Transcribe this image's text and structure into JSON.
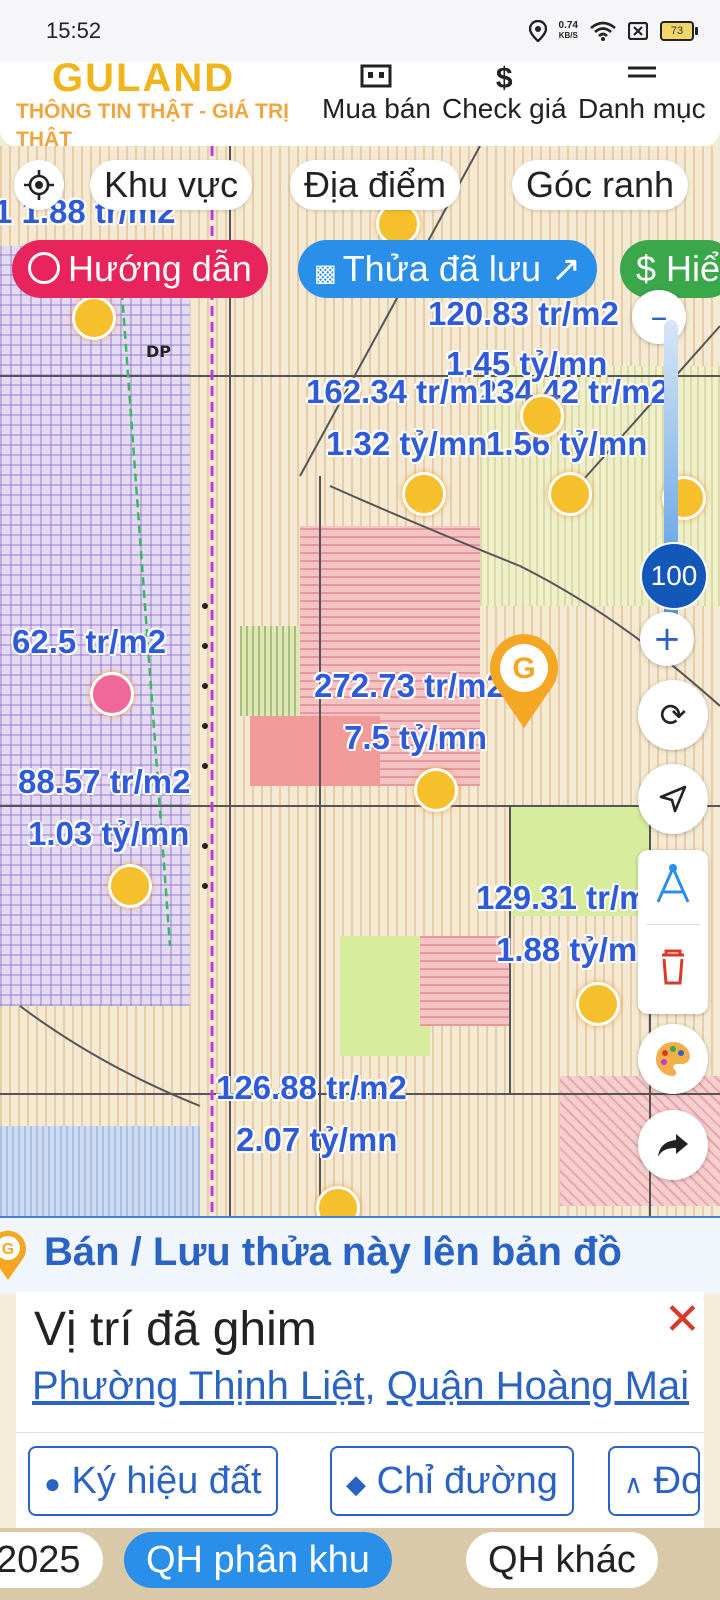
{
  "status": {
    "time": "15:52",
    "net_speed_value": "0.74",
    "net_speed_unit": "KB/S",
    "battery": "73"
  },
  "header": {
    "logo": "GULAND",
    "slogan": "THÔNG TIN THẬT - GIÁ TRỊ THẬT",
    "nav": [
      {
        "label": "Mua bán",
        "icon": "building-icon"
      },
      {
        "label": "Check giá",
        "icon": "dollar-icon"
      },
      {
        "label": "Danh mục",
        "icon": "menu-icon"
      }
    ]
  },
  "filters": {
    "area": "Khu vực",
    "place": "Địa điểm",
    "corner": "Góc ranh"
  },
  "actions": {
    "guide": "Hướng dẫn",
    "saved": "Thửa đã lưu ↗",
    "third": "$ Hiể"
  },
  "zoom": {
    "level": "100"
  },
  "labels": {
    "l0": "1 1.88 tr/m2",
    "l1_price": "120.83 tr/m2",
    "l1_total": "1.45 tỷ/mn",
    "l2_price": "162.34 tr/m2",
    "l2_total": "1.32 tỷ/mn",
    "l3_price": "134.42 tr/m2",
    "l3_total": "1.56 tỷ/mn",
    "l4_price": "62.5 tr/m2",
    "l5_price": "272.73 tr/m2",
    "l5_total": "7.5 tỷ/mn",
    "l6_price": "88.57 tr/m2",
    "l6_total": "1.03 tỷ/mn",
    "l7_price": "129.31 tr/m2",
    "l7_total": "1.88 tỷ/mn",
    "l8_price": "126.88 tr/m2",
    "l8_total": "2.07 tỷ/mn",
    "dp": "DP"
  },
  "bottom": {
    "save_prompt": "Bán / Lưu thửa này lên bản đồ",
    "pin_title": "Vị trí đã ghim",
    "ward": "Phường Thịnh Liệt",
    "district": "Quận Hoàng Mai",
    "close": "✕",
    "btn_symbols": "Ký hiệu đất",
    "btn_directions": "Chỉ đường",
    "btn_measure": "Đo"
  },
  "layers": {
    "year": "2025",
    "zone": "QH phân khu",
    "other": "QH khác"
  },
  "colors": {
    "blue": "#2a63c4",
    "pink": "#e8245c",
    "green": "#3aa74a",
    "gold": "#f0b51b",
    "zoom": "#1357b8"
  }
}
